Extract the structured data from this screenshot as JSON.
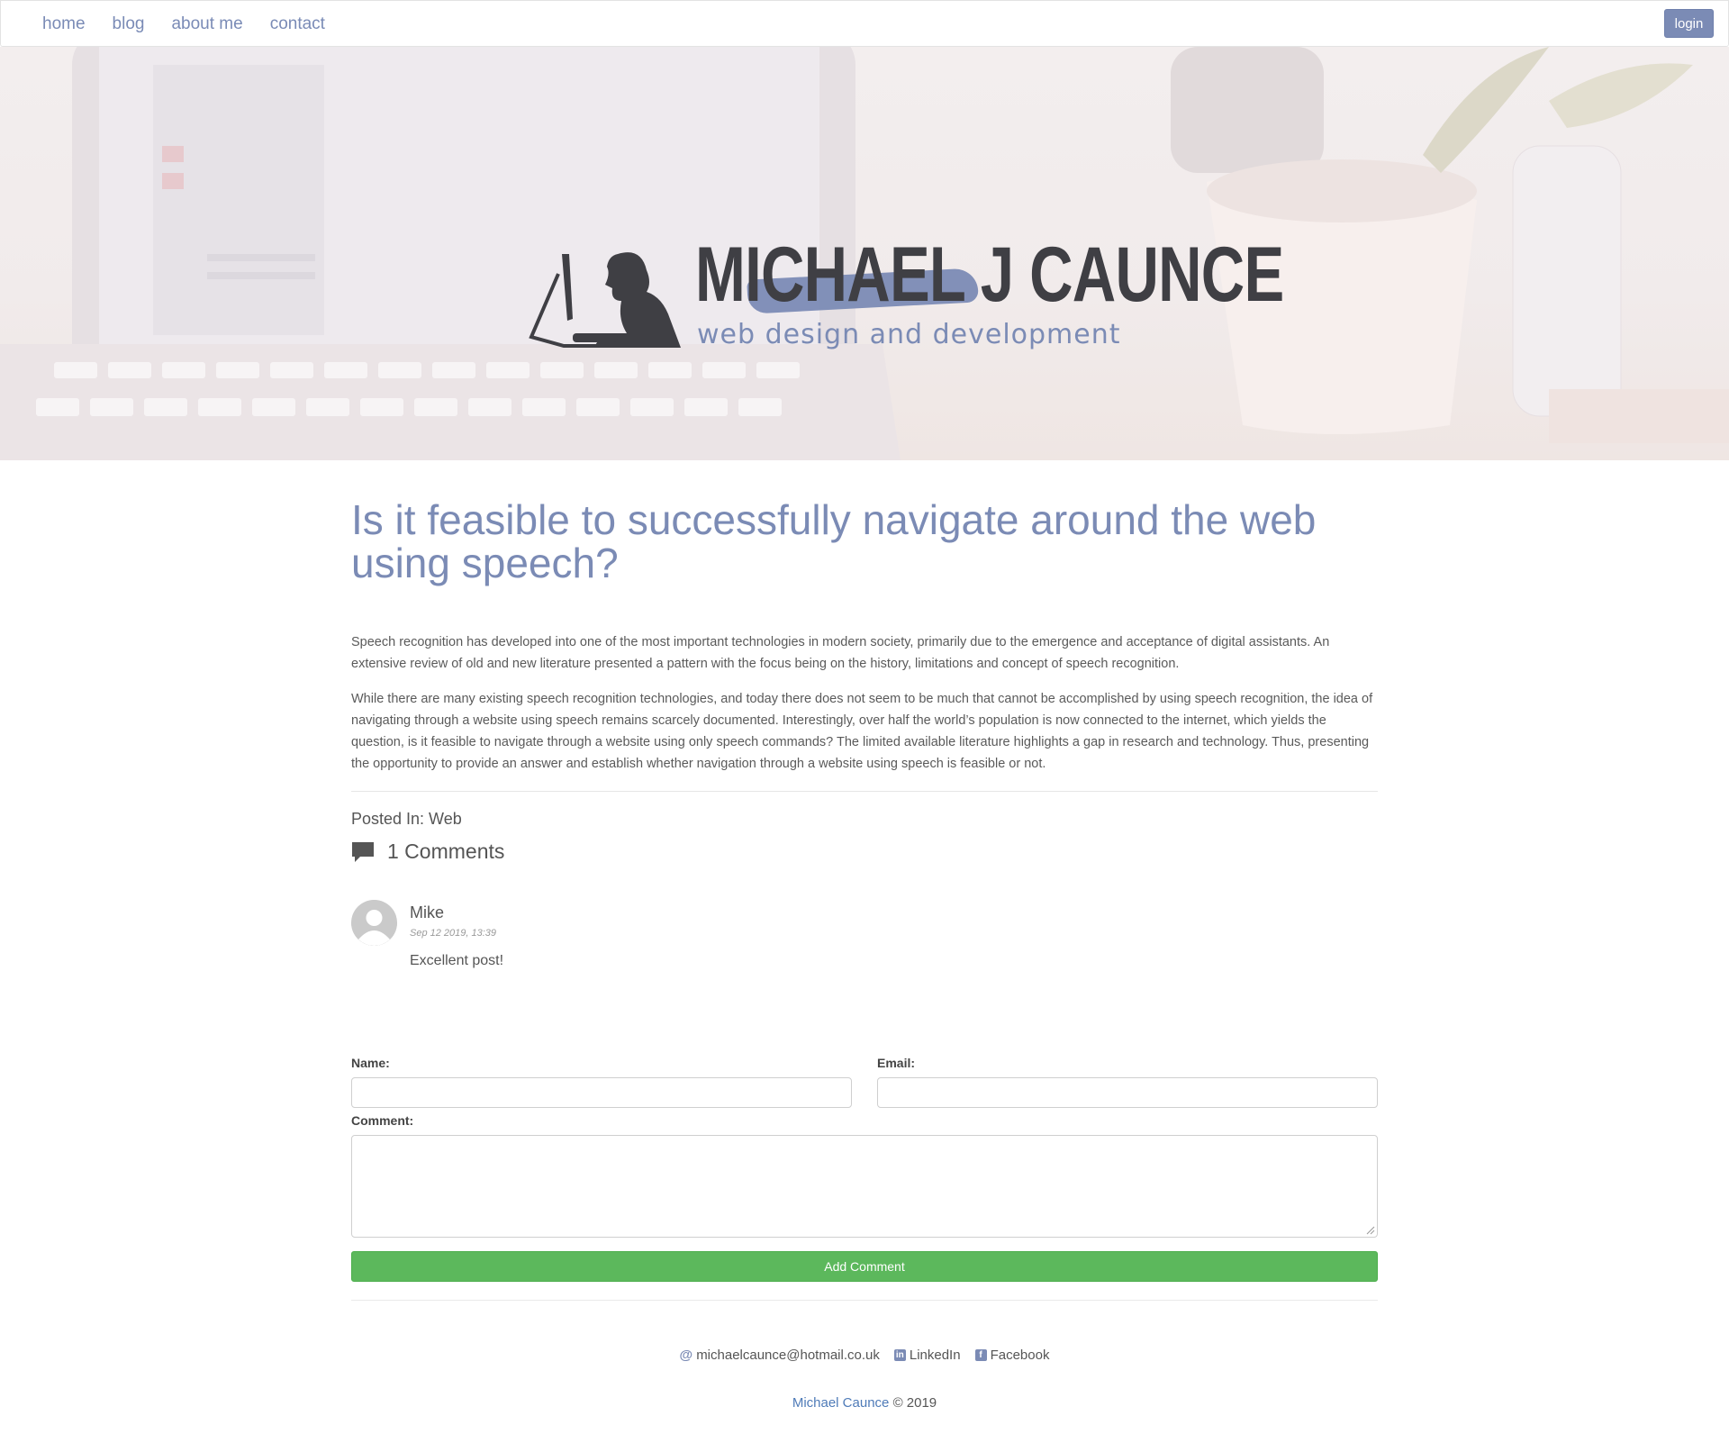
{
  "nav": {
    "links": [
      "home",
      "blog",
      "about me",
      "contact"
    ],
    "login_label": "login"
  },
  "hero": {
    "logo_title": "MICHAEL J CAUNCE",
    "logo_subtitle": "web design and development"
  },
  "post": {
    "title": "Is it feasible to successfully navigate around the web using speech?",
    "paragraphs": [
      "Speech recognition has developed into one of the most important technologies in modern society, primarily due to the emergence and acceptance of digital assistants. An extensive review of old and new literature presented a pattern with the focus being on the history, limitations and concept of speech recognition.",
      "While there are many existing speech recognition technologies, and today there does not seem to be much that cannot be accomplished by using speech recognition, the idea of navigating through a website using speech remains scarcely documented. Interestingly, over half the world’s population is now connected to the internet, which yields the question, is it feasible to navigate through a website using only speech commands? The limited available literature highlights a gap in research and technology. Thus, presenting the opportunity to provide an answer and establish whether navigation through a website using speech is feasible or not."
    ],
    "posted_in": "Posted In: Web",
    "comments_count_label": "1 Comments"
  },
  "comments": [
    {
      "author": "Mike",
      "date": "Sep 12 2019, 13:39",
      "text": "Excellent post!"
    }
  ],
  "form": {
    "name_label": "Name:",
    "email_label": "Email:",
    "comment_label": "Comment:",
    "submit_label": "Add Comment"
  },
  "footer": {
    "email": "michaelcaunce@hotmail.co.uk",
    "linkedin": "LinkedIn",
    "facebook": "Facebook",
    "copyright_name": "Michael Caunce",
    "copyright_rest": "© 2019"
  },
  "colors": {
    "accent": "#7b8bb5",
    "button_green": "#5cb85c",
    "link_blue": "#4f7bb8"
  },
  "icons": [
    "chat-icon",
    "at-icon",
    "linkedin-icon",
    "facebook-icon",
    "avatar-placeholder-icon"
  ]
}
